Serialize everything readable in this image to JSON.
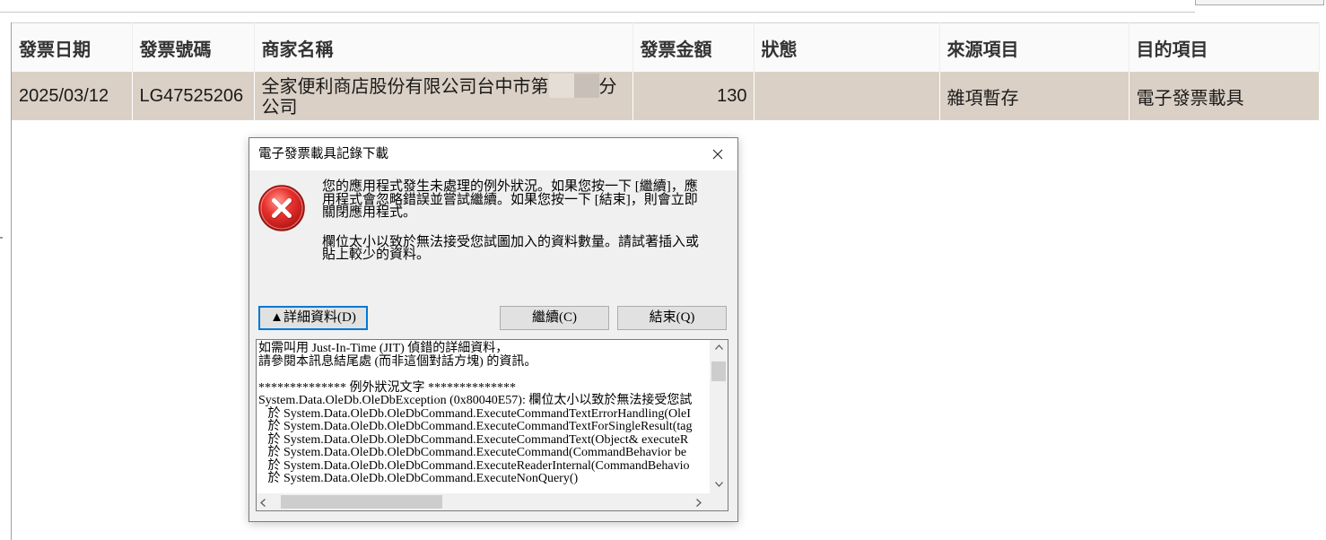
{
  "grid": {
    "columns": [
      "發票日期",
      "發票號碼",
      "商家名稱",
      "發票金額",
      "狀態",
      "來源項目",
      "目的項目"
    ],
    "rows": [
      {
        "invoice_date": "2025/03/12",
        "invoice_number": "LG47525206",
        "merchant_name_part1": "全家便利商店股份有限公司台中市第",
        "merchant_name_part2": "分",
        "merchant_name_line2": "公司",
        "amount": "130",
        "status": "",
        "source_item": "雜項暫存",
        "target_item": "電子發票載具",
        "selected": true
      }
    ]
  },
  "dialog": {
    "title": "電子發票載具記錄下載",
    "icon": "error-icon",
    "message": "您的應用程式發生未處理的例外狀況。如果您按一下 [繼續]，應用程式會忽略錯誤並嘗試繼續。如果您按一下 [結束]，則會立即關閉應用程式。",
    "error_message": "欄位太小以致於無法接受您試圖加入的資料數量。請試著插入或貼上較少的資料。",
    "details_button": "▲詳細資料(D)",
    "continue_button": "繼續(C)",
    "quit_button": "結束(Q)",
    "details_lines": [
      "如需叫用 Just-In-Time (JIT) 偵錯的詳細資料，",
      "請參閱本訊息結尾處 (而非這個對話方塊) 的資訊。",
      "",
      "************** 例外狀況文字 **************",
      "System.Data.OleDb.OleDbException (0x80040E57): 欄位太小以致於無法接受您試",
      "   於 System.Data.OleDb.OleDbCommand.ExecuteCommandTextErrorHandling(OleI",
      "   於 System.Data.OleDb.OleDbCommand.ExecuteCommandTextForSingleResult(tag",
      "   於 System.Data.OleDb.OleDbCommand.ExecuteCommandText(Object& executeR",
      "   於 System.Data.OleDb.OleDbCommand.ExecuteCommand(CommandBehavior be",
      "   於 System.Data.OleDb.OleDbCommand.ExecuteReaderInternal(CommandBehavio",
      "   於 System.Data.OleDb.OleDbCommand.ExecuteNonQuery()"
    ]
  },
  "colors": {
    "selected_row_background": "#dbd0c5",
    "focus_border": "#0078d7",
    "error_icon_red": "#e8322e",
    "dialog_background": "#f0f0f0"
  }
}
